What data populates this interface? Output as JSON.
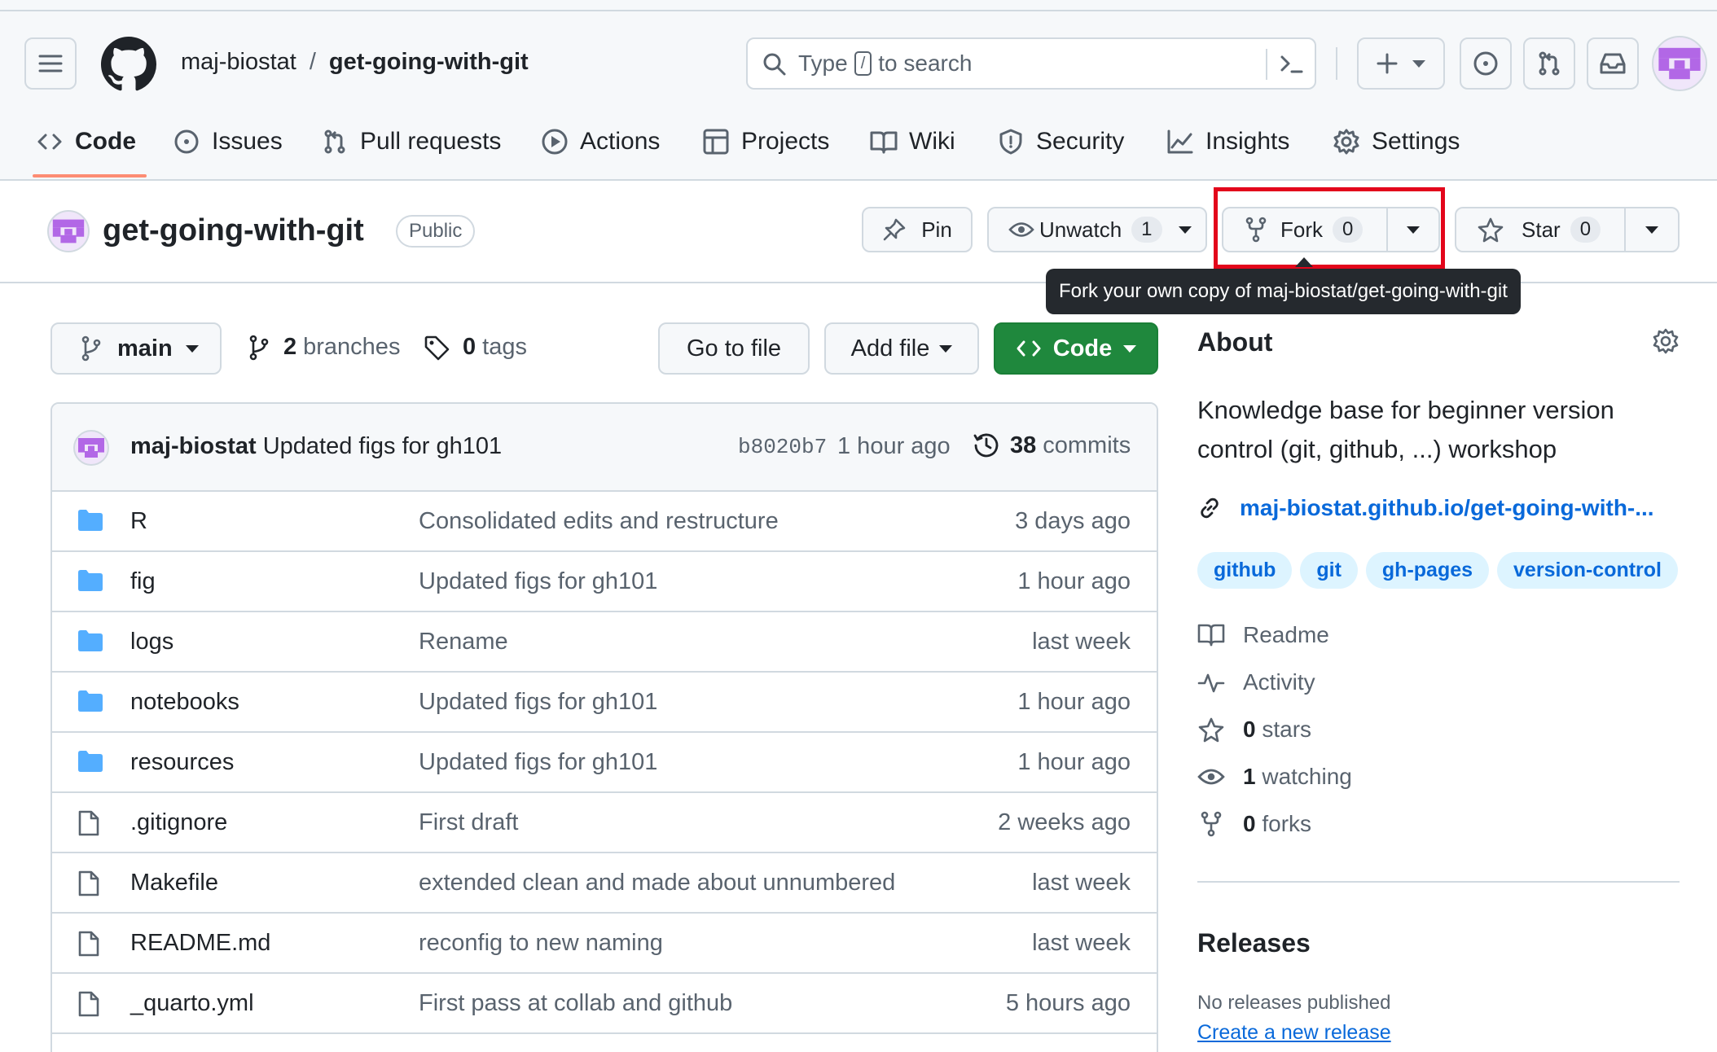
{
  "header": {
    "owner": "maj-biostat",
    "separator": "/",
    "repo": "get-going-with-git",
    "search_prefix": "Type",
    "search_key": "/",
    "search_suffix": "to search"
  },
  "tabs": [
    {
      "label": "Code",
      "icon": "code-icon"
    },
    {
      "label": "Issues",
      "icon": "issue-icon"
    },
    {
      "label": "Pull requests",
      "icon": "pull-request-icon"
    },
    {
      "label": "Actions",
      "icon": "play-icon"
    },
    {
      "label": "Projects",
      "icon": "table-icon"
    },
    {
      "label": "Wiki",
      "icon": "book-icon"
    },
    {
      "label": "Security",
      "icon": "shield-icon"
    },
    {
      "label": "Insights",
      "icon": "graph-icon"
    },
    {
      "label": "Settings",
      "icon": "gear-icon"
    }
  ],
  "repo_bar": {
    "title": "get-going-with-git",
    "visibility": "Public",
    "pin": "Pin",
    "unwatch": "Unwatch",
    "watch_count": "1",
    "fork": "Fork",
    "fork_count": "0",
    "star": "Star",
    "star_count": "0",
    "tooltip": "Fork your own copy of maj-biostat/get-going-with-git"
  },
  "toolbar": {
    "branch": "main",
    "branches_count": "2",
    "branches_label": "branches",
    "tags_count": "0",
    "tags_label": "tags",
    "goto_file": "Go to file",
    "add_file": "Add file",
    "code": "Code"
  },
  "commit": {
    "author": "maj-biostat",
    "message": "Updated figs for gh101",
    "sha": "b8020b7",
    "time": "1 hour ago",
    "commits_count": "38",
    "commits_label": "commits"
  },
  "files": [
    {
      "type": "folder",
      "name": "R",
      "message": "Consolidated edits and restructure",
      "time": "3 days ago"
    },
    {
      "type": "folder",
      "name": "fig",
      "message": "Updated figs for gh101",
      "time": "1 hour ago"
    },
    {
      "type": "folder",
      "name": "logs",
      "message": "Rename",
      "time": "last week"
    },
    {
      "type": "folder",
      "name": "notebooks",
      "message": "Updated figs for gh101",
      "time": "1 hour ago"
    },
    {
      "type": "folder",
      "name": "resources",
      "message": "Updated figs for gh101",
      "time": "1 hour ago"
    },
    {
      "type": "file",
      "name": ".gitignore",
      "message": "First draft",
      "time": "2 weeks ago"
    },
    {
      "type": "file",
      "name": "Makefile",
      "message": "extended clean and made about unnumbered",
      "time": "last week"
    },
    {
      "type": "file",
      "name": "README.md",
      "message": "reconfig to new naming",
      "time": "last week"
    },
    {
      "type": "file",
      "name": "_quarto.yml",
      "message": "First pass at collab and github",
      "time": "5 hours ago"
    }
  ],
  "about": {
    "heading": "About",
    "description_line1": "Knowledge base for beginner version",
    "description_line2": "control (git, github, ...) workshop",
    "link": "maj-biostat.github.io/get-going-with-...",
    "topics": [
      "github",
      "git",
      "gh-pages",
      "version-control"
    ],
    "readme": "Readme",
    "activity": "Activity",
    "stars_count": "0",
    "stars_label": "stars",
    "watching_count": "1",
    "watching_label": "watching",
    "forks_count": "0",
    "forks_label": "forks"
  },
  "releases": {
    "heading": "Releases",
    "none": "No releases published",
    "create": "Create a new release"
  },
  "colors": {
    "accent_green": "#1f883d",
    "link_blue": "#0969da",
    "highlight_red": "#e3061b",
    "tab_underline": "#fd8c73",
    "folder_blue": "#54aeff"
  }
}
